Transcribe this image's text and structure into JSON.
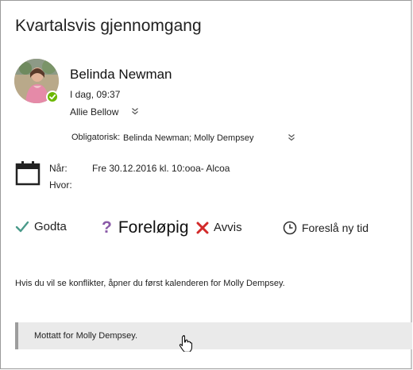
{
  "meeting": {
    "title": "Kvartalsvis gjennomgang"
  },
  "organizer": {
    "name": "Belinda Newman",
    "time": "I dag, 09:37",
    "to": "Allie Bellow",
    "presence_color": "#6bb700"
  },
  "attendees": {
    "required_label": "Obligatorisk:",
    "required_value": "Belinda Newman; Molly Dempsey"
  },
  "details": {
    "when_label": "Når:",
    "when_value": "Fre 30.12.2016 kl. 10:ooa- Alcoa",
    "where_label": "Hvor:",
    "where_value": ""
  },
  "actions": {
    "accept": "Godta",
    "tentative": "Foreløpig",
    "decline": "Avvis",
    "propose": "Foreslå ny tid",
    "accept_color": "#4a9a8a",
    "tentative_color": "#8a5aa8",
    "decline_color": "#d22a2a"
  },
  "info_text": "Hvis du vil se konflikter, åpner du først kalenderen for Molly Dempsey.",
  "banner": {
    "text": "Mottatt for Molly Dempsey."
  },
  "icons": [
    "calendar-icon",
    "checkmark-icon",
    "question-icon",
    "x-icon",
    "clock-icon",
    "chevron-down-icon",
    "cursor-icon"
  ]
}
